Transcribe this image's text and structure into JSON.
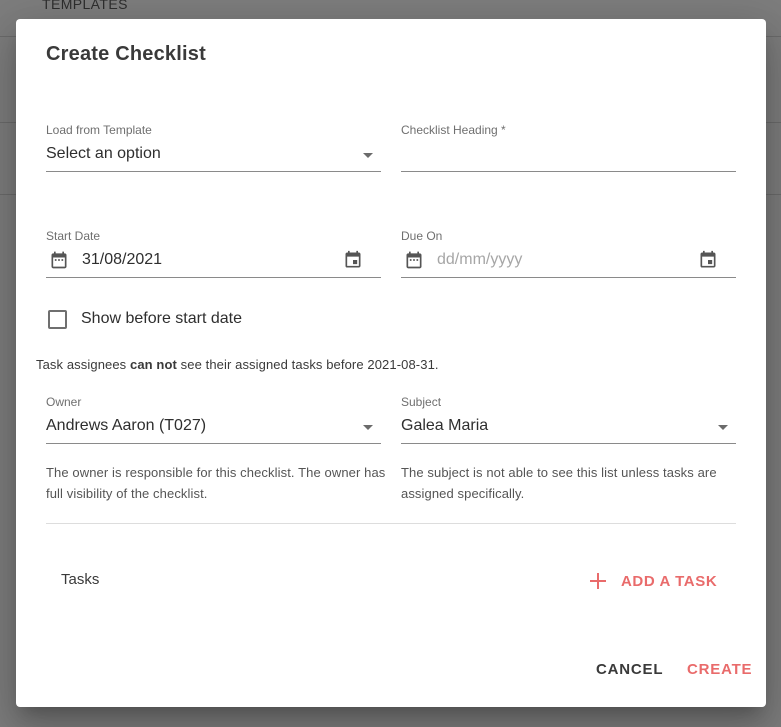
{
  "background": {
    "tab_label": "TEMPLATES"
  },
  "dialog": {
    "title": "Create Checklist",
    "load_template": {
      "label": "Load from Template",
      "value": "Select an option"
    },
    "heading": {
      "label": "Checklist Heading *",
      "value": ""
    },
    "start_date": {
      "label": "Start Date",
      "value": "31/08/2021"
    },
    "due_on": {
      "label": "Due On",
      "placeholder": "dd/mm/yyyy"
    },
    "show_before_start": {
      "label": "Show before start date",
      "checked": false
    },
    "notice": {
      "prefix": "Task assignees ",
      "emphasis": "can not",
      "suffix": " see their assigned tasks before 2021-08-31."
    },
    "owner": {
      "label": "Owner",
      "value": "Andrews Aaron (T027)",
      "hint": "The owner is responsible for this checklist. The owner has full visibility of the checklist."
    },
    "subject": {
      "label": "Subject",
      "value": "Galea Maria",
      "hint": "The subject is not able to see this list unless tasks are assigned specifically."
    },
    "tasks_label": "Tasks",
    "add_task_label": "ADD A TASK",
    "cancel_label": "CANCEL",
    "create_label": "CREATE"
  },
  "colors": {
    "accent": "#e96b6b",
    "text": "#2e2e2e",
    "muted": "#6f6f6f",
    "overlay": "#7a7a7a"
  },
  "icons": [
    "calendar-icon",
    "dropdown-caret-icon",
    "plus-icon",
    "checkbox-icon"
  ]
}
